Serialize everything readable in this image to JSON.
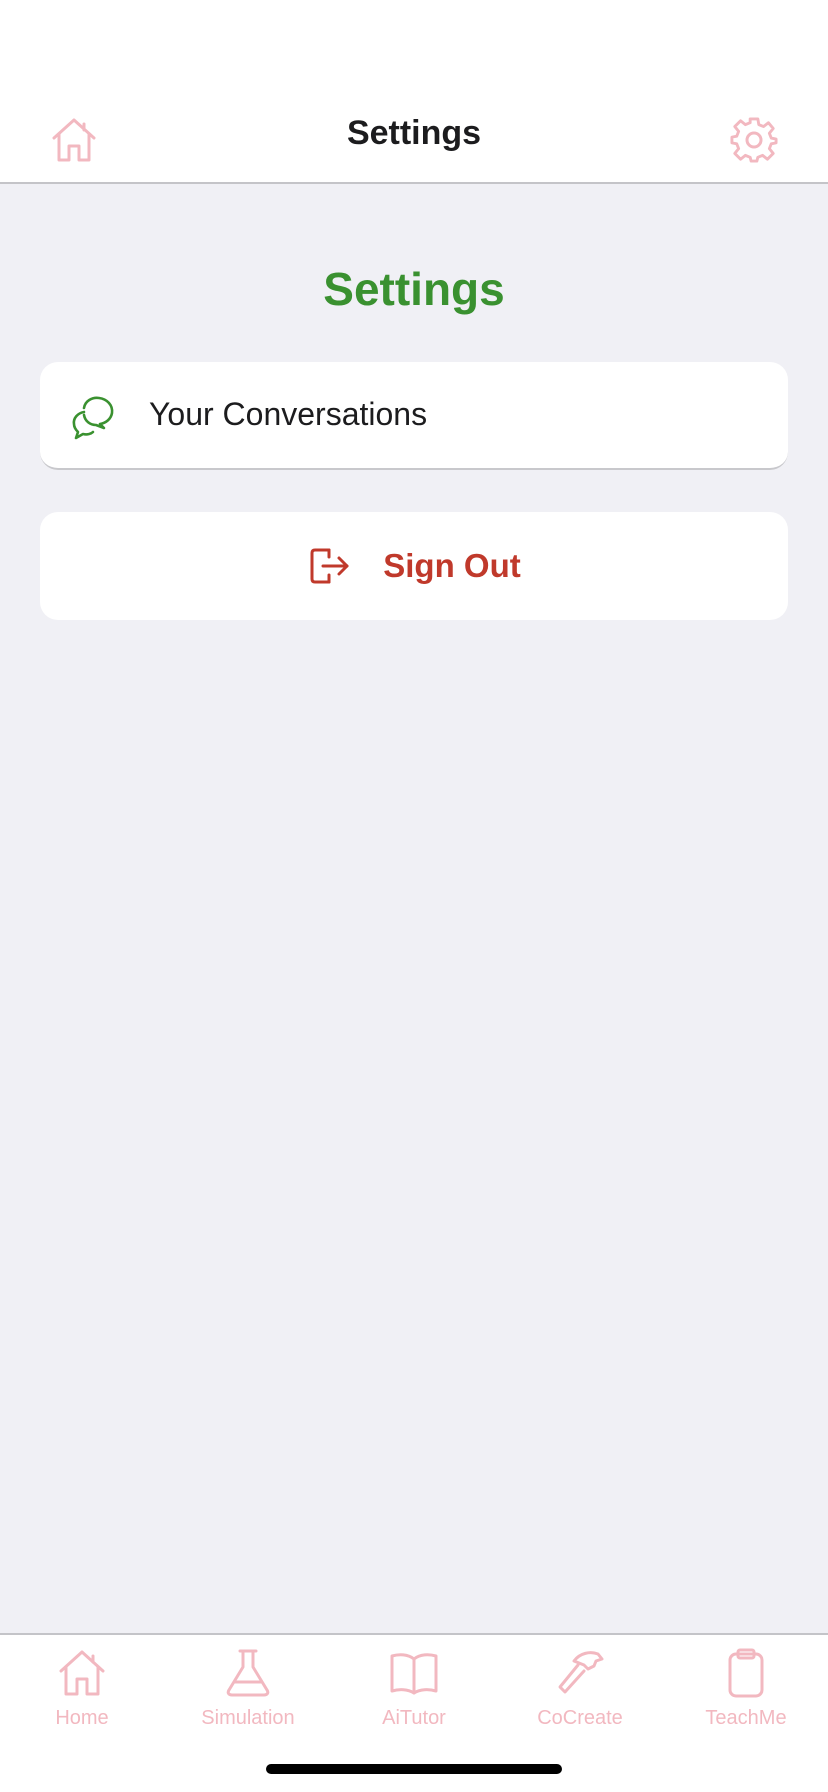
{
  "nav": {
    "title": "Settings",
    "left_icon": "home-icon",
    "right_icon": "gear-icon"
  },
  "main": {
    "heading": "Settings",
    "conversations": {
      "label": "Your Conversations",
      "icon": "chat-bubbles-icon"
    },
    "sign_out": {
      "label": "Sign Out",
      "icon": "logout-icon"
    }
  },
  "tabs": [
    {
      "label": "Home",
      "icon": "home-icon"
    },
    {
      "label": "Simulation",
      "icon": "flask-icon"
    },
    {
      "label": "AiTutor",
      "icon": "book-icon"
    },
    {
      "label": "CoCreate",
      "icon": "hammer-icon"
    },
    {
      "label": "TeachMe",
      "icon": "clipboard-icon"
    }
  ],
  "colors": {
    "accent_pink": "#f2b8c0",
    "heading_green": "#3a9130",
    "signout_red": "#c0392b",
    "background": "#f0f0f5"
  }
}
